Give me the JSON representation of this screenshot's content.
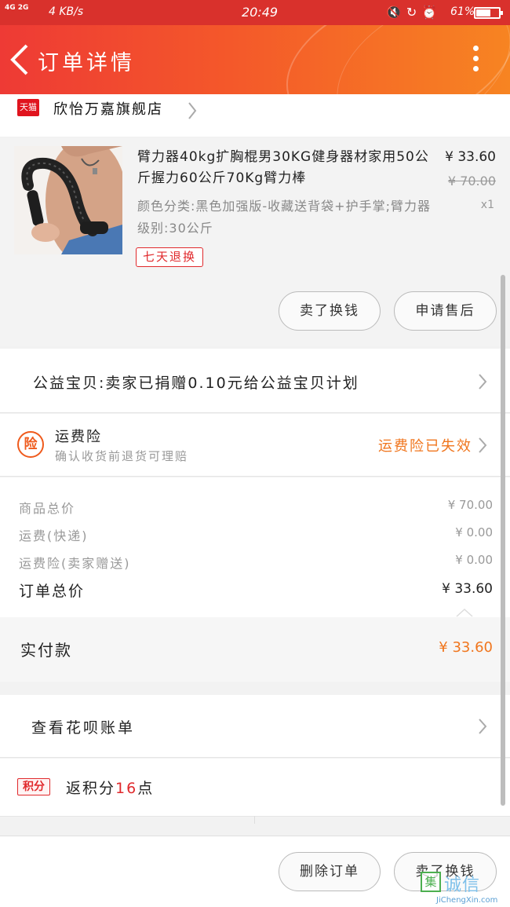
{
  "status_bar": {
    "network_types": "4G 2G",
    "net_speed": "4 KB/s",
    "time": "20:49",
    "icons": [
      "mute-vibrate-icon",
      "rotation-lock-icon",
      "alarm-icon"
    ],
    "battery_text": "61%",
    "battery_level": 0.61
  },
  "header": {
    "title": "订单详情",
    "theme_color": "#ee3a35"
  },
  "store": {
    "platform_badge": "天猫",
    "name": "欣怡万嘉旗舰店"
  },
  "product": {
    "title": "臂力器40kg扩胸棍男30KG健身器材家用50公斤握力60公斤70Kg臂力棒",
    "sku": "颜色分类:黑色加强版-收藏送背袋+护手掌;臂力器级别:30公斤",
    "price": "¥ 33.60",
    "original_price": "¥ 70.00",
    "quantity": "x1",
    "return_tag": "七天退换",
    "buttons": [
      "卖了换钱",
      "申请售后"
    ]
  },
  "charity": {
    "text": "公益宝贝:卖家已捐赠0.10元给公益宝贝计划"
  },
  "insurance": {
    "badge": "险",
    "title": "运费险",
    "subtitle": "确认收货前退货可理赔",
    "status": "运费险已失效",
    "status_color": "#f0761e"
  },
  "summary": {
    "rows": [
      {
        "label": "商品总价",
        "value": "¥ 70.00"
      },
      {
        "label": "运费(快递)",
        "value": "¥ 0.00"
      },
      {
        "label": "运费险(卖家赠送)",
        "value": "¥ 0.00"
      }
    ],
    "total_label": "订单总价",
    "total_value": "¥ 33.60"
  },
  "paid": {
    "label": "实付款",
    "value": "¥ 33.60"
  },
  "huabei": {
    "text": "查看花呗账单"
  },
  "points": {
    "badge": "积分",
    "prefix": "返积分",
    "amount": "16",
    "suffix": "点"
  },
  "bottom_bar": {
    "buttons": [
      "删除订单",
      "卖了换钱"
    ]
  },
  "watermark": {
    "mark": "集",
    "cn": "诚信",
    "en": "JiChengXin.com"
  }
}
